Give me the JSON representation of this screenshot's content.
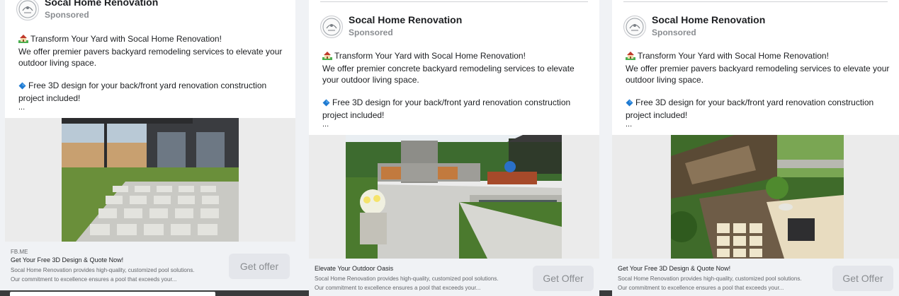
{
  "colors": {
    "page_background": "#f0f2f5",
    "card_background": "#ffffff",
    "button_background": "#e4e6eb",
    "button_text": "#8a8d91",
    "sponsored_text": "#8a8d91",
    "diamond_blue": "#1f7ad1",
    "house_green": "#4caf50"
  },
  "icons": {
    "house": "house-with-garden-emoji",
    "diamond": "small-blue-diamond-emoji",
    "avatar": "company-logo-icon"
  },
  "ads": [
    {
      "page_name": "Socal Home Renovation",
      "sponsored": "Sponsored",
      "headline_text": "Transform Your Yard with Socal Home Renovation!",
      "body_line_1": "We offer premier pavers backyard remodeling services to elevate your outdoor living space.",
      "offer_text": "Free 3D design for your back/front yard renovation construction project included!",
      "ellipsis": "...",
      "image_alt": "Backyard patio with square pavers and grass",
      "footer_domain": "FB.ME",
      "footer_headline": "Get Your Free 3D Design & Quote Now!",
      "footer_desc_line_1": "Socal Home Renovation provides high-quality, customized pool solutions.",
      "footer_desc_line_2": "Our commitment to excellence ensures a pool that exceeds your...",
      "button_label": "Get offer"
    },
    {
      "page_name": "Socal Home Renovation",
      "sponsored": "Sponsored",
      "headline_text": "Transform Your Yard with Socal Home Renovation!",
      "body_line_1": "We offer premier concrete backyard remodeling services to elevate your outdoor living space.",
      "offer_text": "Free 3D design for your back/front yard renovation construction project included!",
      "ellipsis": "...",
      "image_alt": "Concrete patio with stone fireplace and dining set",
      "footer_headline": "Elevate Your Outdoor Oasis",
      "footer_desc_line_1": "Socal Home Renovation provides high-quality, customized pool solutions.",
      "footer_desc_line_2": "Our commitment to excellence ensures a pool that exceeds your...",
      "button_label": "Get Offer"
    },
    {
      "page_name": "Socal Home Renovation",
      "sponsored": "Sponsored",
      "headline_text": "Transform Your Yard with Socal Home Renovation!",
      "body_line_1": "We offer premier pavers backyard remodeling services to elevate your outdoor living space.",
      "offer_text": "Free 3D design for your back/front yard renovation construction project included!",
      "ellipsis": "...",
      "image_alt": "Terraced garden with deck, pavers and lawn",
      "footer_headline": "Get Your Free 3D Design & Quote Now!",
      "footer_desc_line_1": "Socal Home Renovation provides high-quality, customized pool solutions.",
      "footer_desc_line_2": "Our commitment to excellence ensures a pool that exceeds your...",
      "button_label": "Get Offer"
    }
  ]
}
